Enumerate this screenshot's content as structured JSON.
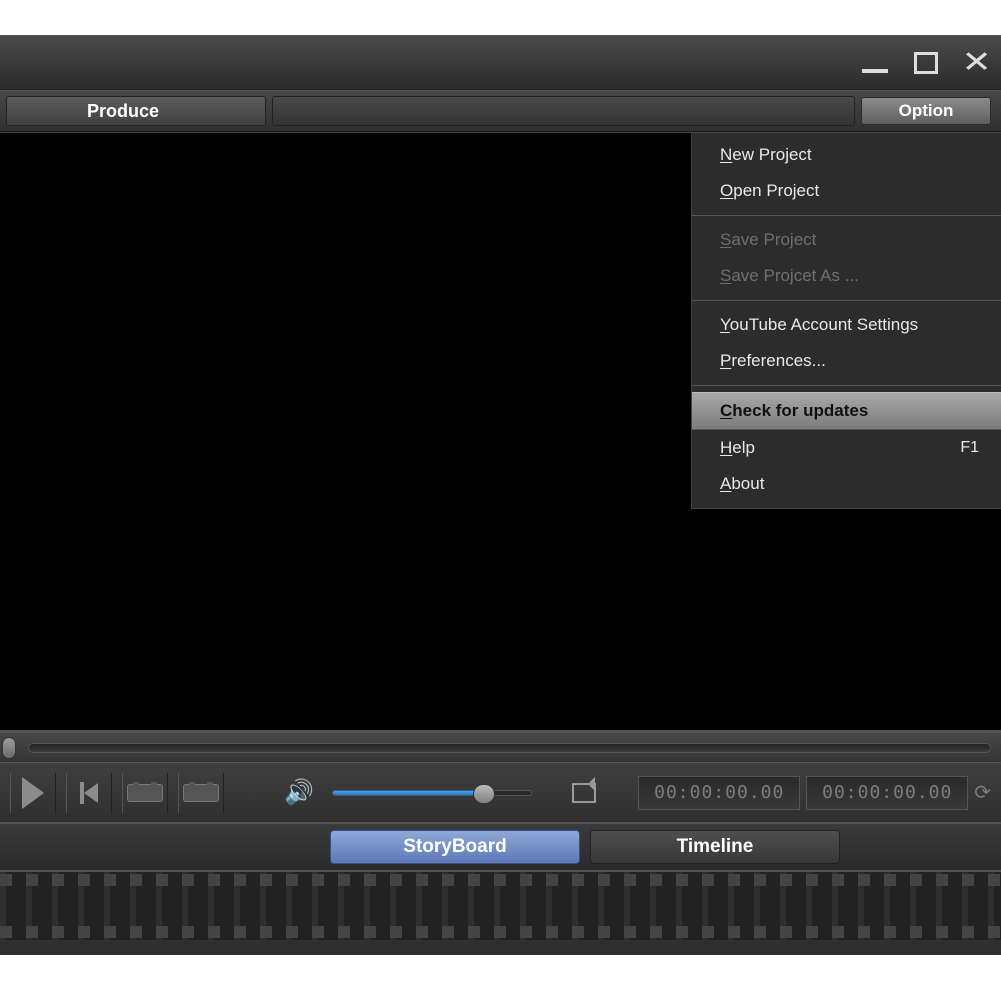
{
  "toolbar": {
    "produce": "Produce",
    "option": "Option"
  },
  "menu": {
    "new_project": "ew Project",
    "open_project": "pen Project",
    "save_project": "ave Project",
    "save_project_as": "ave Projcet As ...",
    "youtube_settings": "ouTube Account Settings",
    "preferences": "references...",
    "check_updates": "heck for updates",
    "help": "elp",
    "help_shortcut": "F1",
    "about": "bout",
    "mnemonic": {
      "new_project": "N",
      "open_project": "O",
      "save_project": "S",
      "save_project_as": "S",
      "youtube_settings": "Y",
      "preferences": "P",
      "check_updates": "C",
      "help": "H",
      "about": "A"
    }
  },
  "timecode": {
    "current": "00:00:00.00",
    "total": "00:00:00.00"
  },
  "view_tabs": {
    "storyboard": "StoryBoard",
    "timeline": "Timeline"
  }
}
